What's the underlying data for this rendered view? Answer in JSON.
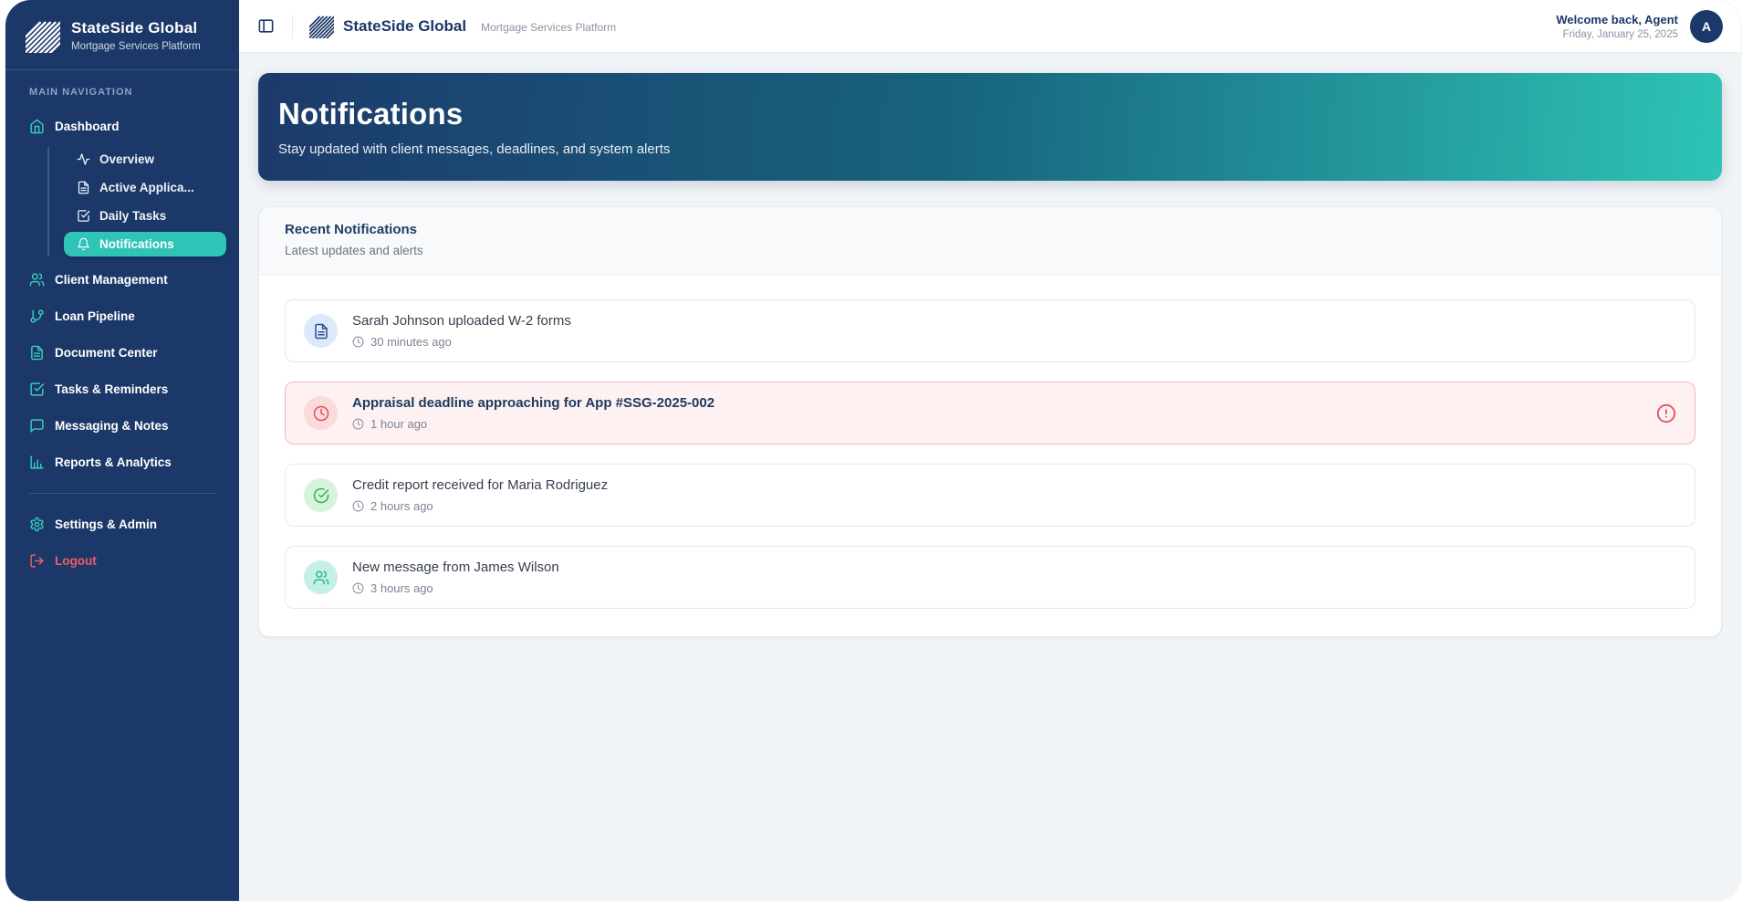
{
  "colors": {
    "sidebar_navy": "#1b3868",
    "teal_accent": "#2ec4b6",
    "logout_red": "#f15b68",
    "urgent_bg": "#fdf1f1",
    "urgent_border": "#f2b7b7",
    "page_bg": "#f1f4f6"
  },
  "brand": {
    "name": "StateSide Global",
    "tagline": "Mortgage Services Platform"
  },
  "sidebar": {
    "section_label": "MAIN NAVIGATION",
    "dashboard": {
      "label": "Dashboard"
    },
    "dashboard_sub": [
      {
        "label": "Overview"
      },
      {
        "label": "Active Applica..."
      },
      {
        "label": "Daily Tasks"
      },
      {
        "label": "Notifications",
        "active": true
      }
    ],
    "items": [
      {
        "label": "Client Management"
      },
      {
        "label": "Loan Pipeline"
      },
      {
        "label": "Document Center"
      },
      {
        "label": "Tasks & Reminders"
      },
      {
        "label": "Messaging & Notes"
      },
      {
        "label": "Reports & Analytics"
      }
    ],
    "settings": {
      "label": "Settings & Admin"
    },
    "logout": {
      "label": "Logout"
    }
  },
  "header": {
    "welcome": "Welcome back, Agent",
    "date": "Friday, January 25, 2025",
    "avatar_initial": "A"
  },
  "banner": {
    "title": "Notifications",
    "subtitle": "Stay updated with client messages, deadlines, and system alerts"
  },
  "panel": {
    "title": "Recent Notifications",
    "subtitle": "Latest updates and alerts"
  },
  "notifications": [
    {
      "title": "Sarah Johnson uploaded W-2 forms",
      "time": "30 minutes ago",
      "type": "document",
      "urgent": false
    },
    {
      "title": "Appraisal deadline approaching for App #SSG-2025-002",
      "time": "1 hour ago",
      "type": "deadline",
      "urgent": true
    },
    {
      "title": "Credit report received for Maria Rodriguez",
      "time": "2 hours ago",
      "type": "success",
      "urgent": false
    },
    {
      "title": "New message from James Wilson",
      "time": "3 hours ago",
      "type": "message",
      "urgent": false
    }
  ]
}
